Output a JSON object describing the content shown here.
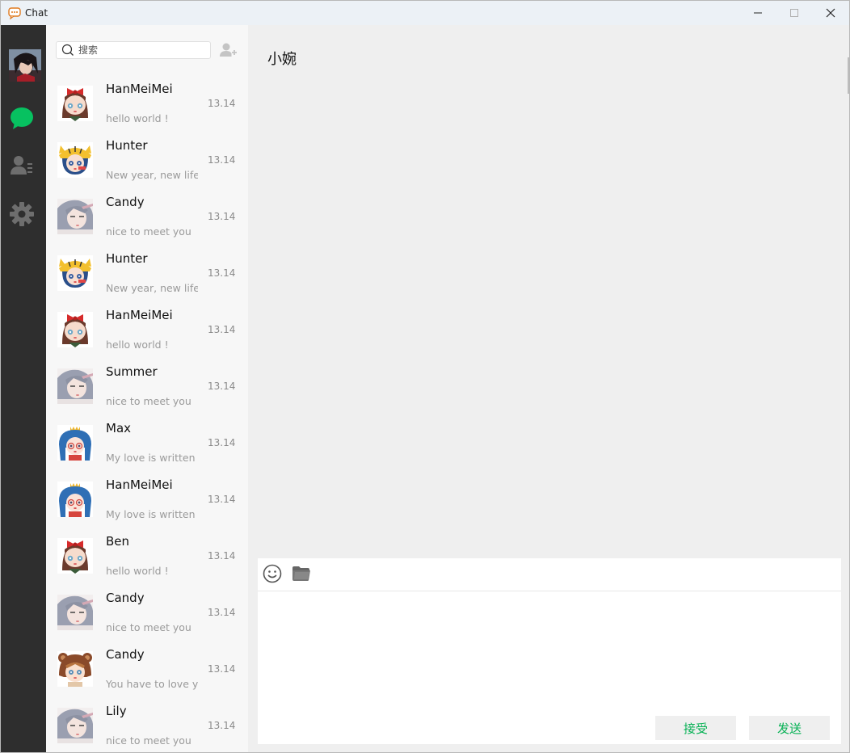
{
  "window": {
    "title": "Chat"
  },
  "colors": {
    "nav_bg": "#2e2e2e",
    "accent": "#07c160",
    "action_text": "#07b155",
    "list_bg": "#f7f7f7",
    "chat_bg": "#efefef"
  },
  "nav": {
    "items": [
      {
        "icon": "chat-bubble-icon",
        "active": true
      },
      {
        "icon": "contacts-icon",
        "active": false
      },
      {
        "icon": "settings-gear-icon",
        "active": false
      }
    ]
  },
  "search": {
    "placeholder": "搜索",
    "value": ""
  },
  "conversations": [
    {
      "name": "HanMeiMei",
      "time": "13.14",
      "message": "hello world !",
      "avatar": "red-bow-girl"
    },
    {
      "name": "Hunter",
      "time": "13.14",
      "message": "New year, new life",
      "avatar": "tiger-hat-girl"
    },
    {
      "name": "Candy",
      "time": "13.14",
      "message": "nice to meet you",
      "avatar": "grey-hair-girl"
    },
    {
      "name": "Hunter",
      "time": "13.14",
      "message": "New year, new life",
      "avatar": "tiger-hat-girl"
    },
    {
      "name": "HanMeiMei",
      "time": "13.14",
      "message": "hello world !",
      "avatar": "red-bow-girl"
    },
    {
      "name": "Summer",
      "time": "13.14",
      "message": "nice to meet you",
      "avatar": "grey-hair-girl"
    },
    {
      "name": "Max",
      "time": "13.14",
      "message": "My love is written ir",
      "avatar": "blue-hood-girl"
    },
    {
      "name": "HanMeiMei",
      "time": "13.14",
      "message": "My love is written ir",
      "avatar": "blue-hood-girl"
    },
    {
      "name": "Ben",
      "time": "13.14",
      "message": "hello world !",
      "avatar": "red-bow-girl"
    },
    {
      "name": "Candy",
      "time": "13.14",
      "message": "nice to meet you",
      "avatar": "grey-hair-girl"
    },
    {
      "name": "Candy",
      "time": "13.14",
      "message": "You have to love yo",
      "avatar": "bear-hat-girl"
    },
    {
      "name": "Lily",
      "time": "13.14",
      "message": "nice to meet you",
      "avatar": "grey-hair-girl"
    }
  ],
  "chat": {
    "title": "小婉",
    "input_value": "",
    "accept_label": "接受",
    "send_label": "发送"
  }
}
